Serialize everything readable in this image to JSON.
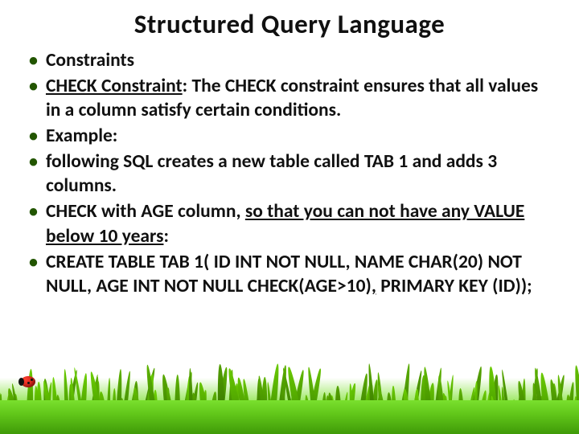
{
  "title": "Structured Query Language",
  "bullets": [
    {
      "html": "Constraints"
    },
    {
      "html": "<span class=\"ul-strong\">CHECK Constraint</span>: The CHECK constraint ensures that all values in a column satisfy certain conditions."
    },
    {
      "html": "Example:"
    },
    {
      "html": "following SQL creates a new table called TAB 1 and adds 3 columns."
    },
    {
      "html": "CHECK with AGE column, <span class=\"u\">so that you can not have any VALUE below 10 years</span>:"
    },
    {
      "html": "CREATE TABLE TAB 1( ID INT NOT NULL, NAME CHAR(20) NOT NULL, AGE INT NOT NULL CHECK(AGE>10)<span class=\"u\">,</span> PRIMARY KEY (ID));"
    }
  ],
  "colors": {
    "bullet_dot": "#225500",
    "grass_light": "#7ae02e",
    "grass_dark": "#3f9a08"
  }
}
